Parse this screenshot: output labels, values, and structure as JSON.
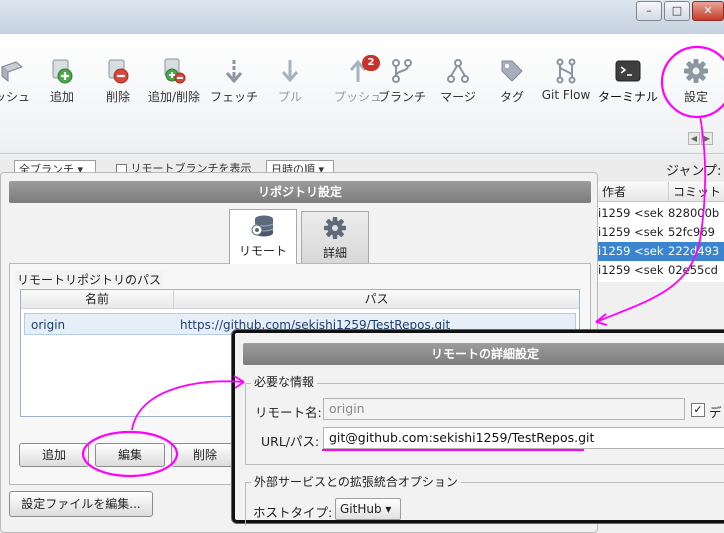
{
  "window": {
    "minimize": "–",
    "maximize": "□",
    "close": "✕"
  },
  "toolbar": {
    "items": [
      {
        "label": "ッシュ",
        "icon": "commit-icon",
        "enabled": true
      },
      {
        "label": "追加",
        "icon": "add-icon",
        "enabled": true
      },
      {
        "label": "削除",
        "icon": "remove-icon",
        "enabled": true
      },
      {
        "label": "追加/削除",
        "icon": "add-remove-icon",
        "enabled": true
      },
      {
        "label": "フェッチ",
        "icon": "fetch-icon",
        "enabled": true
      },
      {
        "label": "プル",
        "icon": "pull-icon",
        "enabled": false
      },
      {
        "label": "プッシュ",
        "icon": "push-icon",
        "enabled": false,
        "badge": "2"
      },
      {
        "label": "ブランチ",
        "icon": "branch-icon",
        "enabled": true
      },
      {
        "label": "マージ",
        "icon": "merge-icon",
        "enabled": true
      },
      {
        "label": "タグ",
        "icon": "tag-icon",
        "enabled": true
      },
      {
        "label": "Git Flow",
        "icon": "git-flow-icon",
        "enabled": true
      },
      {
        "label": "ターミナル",
        "icon": "terminal-icon",
        "enabled": true
      },
      {
        "label": "設定",
        "icon": "gear-icon",
        "enabled": true
      }
    ]
  },
  "filters": {
    "branches": "全ブランチ",
    "show_remote": "リモートブランチを表示",
    "sort": "日時の順"
  },
  "jump_label": "ジャンプ:",
  "commits": {
    "columns": [
      "作者",
      "コミット"
    ],
    "rows": [
      {
        "author": "i1259 <sek",
        "commit": "828000b",
        "selected": false
      },
      {
        "author": "i1259 <sek",
        "commit": "52fc969",
        "selected": false
      },
      {
        "author": "i1259 <sek",
        "commit": "222d493",
        "selected": true
      },
      {
        "author": "i1259 <sek",
        "commit": "02e55cd",
        "selected": false
      }
    ]
  },
  "repo_dialog": {
    "title": "リポジトリ設定",
    "tabs": [
      {
        "label": "リモート",
        "icon": "server-icon",
        "active": true
      },
      {
        "label": "詳細",
        "icon": "gear-icon",
        "active": false
      }
    ],
    "group_title": "リモートリポジトリのパス",
    "columns": [
      "名前",
      "パス"
    ],
    "remotes": [
      {
        "name": "origin",
        "path": "https://github.com/sekishi1259/TestRepos.git"
      }
    ],
    "buttons": {
      "add": "追加",
      "edit": "編集",
      "delete": "削除",
      "edit_config": "設定ファイルを編集..."
    }
  },
  "detail_dialog": {
    "title": "リモートの詳細設定",
    "required_title": "必要な情報",
    "remote_name_label": "リモート名:",
    "remote_name_value": "origin",
    "default_label": "デフ",
    "url_label": "URL/パス:",
    "url_value": "git@github.com:sekishi1259/TestRepos.git",
    "ext_title": "外部サービスとの拡張統合オプション",
    "host_type_label": "ホストタイプ:",
    "host_type_value": "GitHub"
  },
  "colors": {
    "annotation": "#ff00ff",
    "selection": "#3a84d0",
    "badge": "#c8332b"
  }
}
